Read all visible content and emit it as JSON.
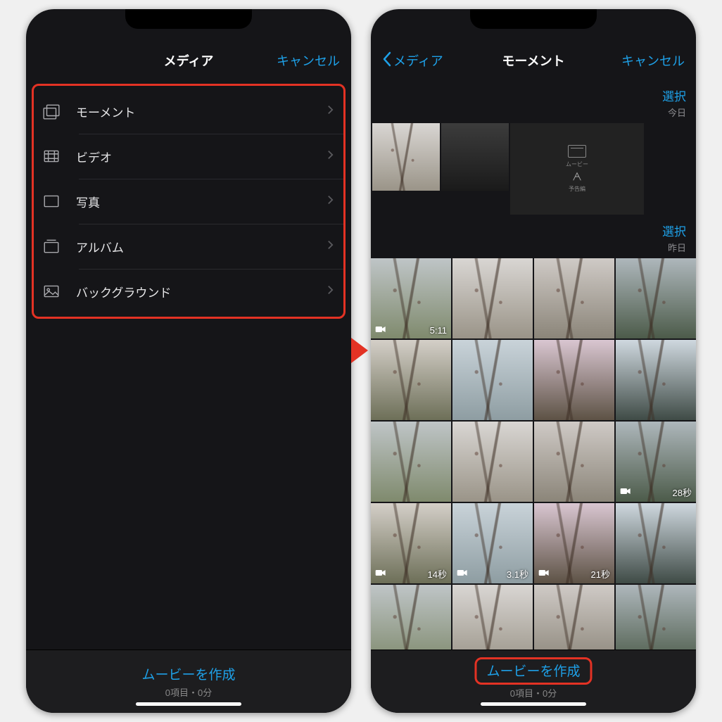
{
  "left": {
    "nav": {
      "title": "メディア",
      "cancel": "キャンセル"
    },
    "menu": [
      {
        "key": "moments",
        "label": "モーメント"
      },
      {
        "key": "video",
        "label": "ビデオ"
      },
      {
        "key": "photo",
        "label": "写真"
      },
      {
        "key": "album",
        "label": "アルバム"
      },
      {
        "key": "background",
        "label": "バックグラウンド"
      }
    ],
    "bottom": {
      "create": "ムービーを作成",
      "status": "0項目・0分"
    }
  },
  "right": {
    "nav": {
      "back": "メディア",
      "title": "モーメント",
      "cancel": "キャンセル"
    },
    "sections": [
      {
        "select": "選択",
        "date": "今日",
        "thumbs": [
          {
            "kind": "photo"
          },
          {
            "kind": "photo"
          },
          {
            "kind": "screenshot",
            "caption_top": "ムービー",
            "caption_bottom": "予告編"
          }
        ]
      },
      {
        "select": "選択",
        "date": "昨日",
        "grid": [
          {
            "kind": "video",
            "dur": "5:11"
          },
          {
            "kind": "photo"
          },
          {
            "kind": "photo"
          },
          {
            "kind": "photo"
          },
          {
            "kind": "photo"
          },
          {
            "kind": "photo"
          },
          {
            "kind": "photo"
          },
          {
            "kind": "photo"
          },
          {
            "kind": "photo"
          },
          {
            "kind": "photo"
          },
          {
            "kind": "photo"
          },
          {
            "kind": "video",
            "dur": "28秒"
          },
          {
            "kind": "video",
            "dur": "14秒"
          },
          {
            "kind": "video",
            "dur": "3.1秒"
          },
          {
            "kind": "video",
            "dur": "21秒"
          },
          {
            "kind": "photo"
          },
          {
            "kind": "photo"
          },
          {
            "kind": "photo"
          },
          {
            "kind": "photo"
          },
          {
            "kind": "photo"
          }
        ]
      }
    ],
    "bottom": {
      "create": "ムービーを作成",
      "status": "0項目・0分"
    }
  }
}
